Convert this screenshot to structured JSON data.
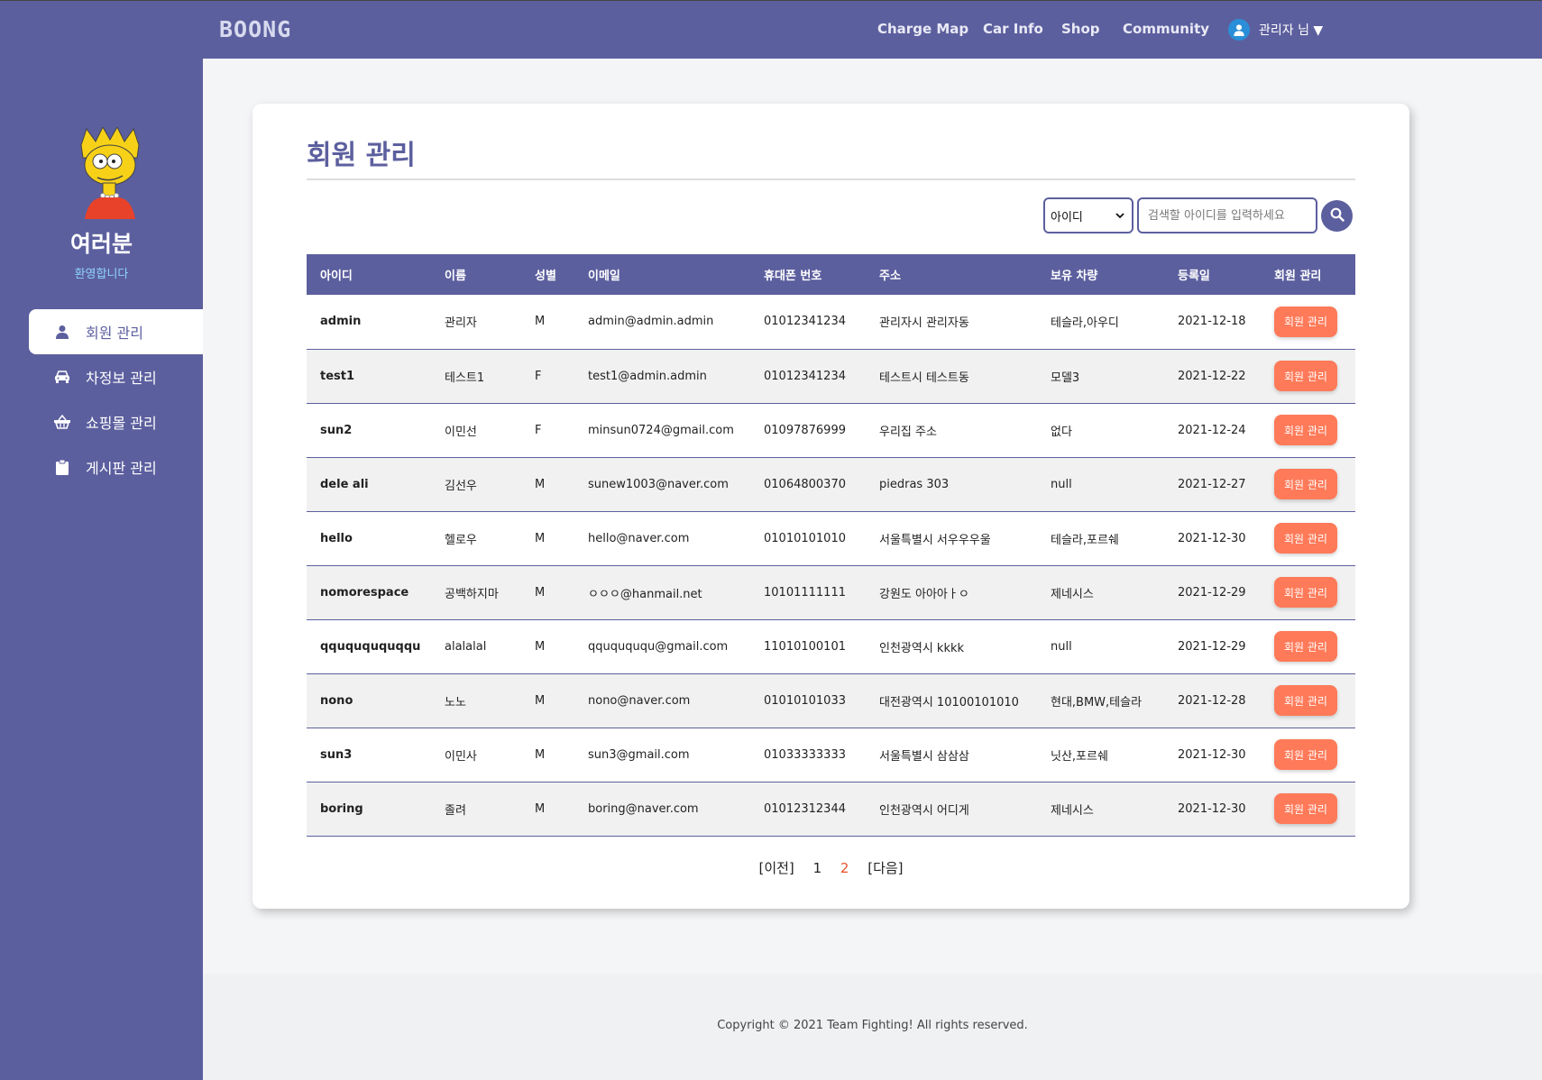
{
  "header": {
    "logo": "BOONG",
    "nav": [
      "Charge Map",
      "Car Info",
      "Shop",
      "Community"
    ],
    "user": "관리자 님 ▼"
  },
  "sidebar": {
    "name": "여러분",
    "welcome": "환영합니다",
    "items": [
      {
        "label": "회원 관리",
        "icon": "user-icon",
        "active": true
      },
      {
        "label": "차정보 관리",
        "icon": "car-icon",
        "active": false
      },
      {
        "label": "쇼핑몰 관리",
        "icon": "basket-icon",
        "active": false
      },
      {
        "label": "게시판 관리",
        "icon": "clipboard-icon",
        "active": false
      }
    ]
  },
  "main": {
    "title": "회원 관리",
    "search": {
      "select_value": "아이디",
      "placeholder": "검색할 아이디를 입력하세요"
    },
    "table": {
      "headers": [
        "아이디",
        "이름",
        "성별",
        "이메일",
        "휴대폰 번호",
        "주소",
        "보유 차량",
        "등록일",
        "회원 관리"
      ],
      "rows": [
        [
          "admin",
          "관리자",
          "M",
          "admin@admin.admin",
          "01012341234",
          "관리자시 관리자동",
          "테슬라,아우디",
          "2021-12-18"
        ],
        [
          "test1",
          "테스트1",
          "F",
          "test1@admin.admin",
          "01012341234",
          "테스트시 테스트동",
          "모델3",
          "2021-12-22"
        ],
        [
          "sun2",
          "이민선",
          "F",
          "minsun0724@gmail.com",
          "01097876999",
          "우리집 주소",
          "없다",
          "2021-12-24"
        ],
        [
          "dele ali",
          "김선우",
          "M",
          "sunew1003@naver.com",
          "01064800370",
          "piedras 303",
          "null",
          "2021-12-27"
        ],
        [
          "hello",
          "헬로우",
          "M",
          "hello@naver.com",
          "01010101010",
          "서울특별시 서우우우울",
          "테슬라,포르쉐",
          "2021-12-30"
        ],
        [
          "nomorespace",
          "공백하지마",
          "M",
          "ㅇㅇㅇ@hanmail.net",
          "10101111111",
          "강원도 아아아ㅏㅇ",
          "제네시스",
          "2021-12-29"
        ],
        [
          "qququququqqu",
          "alalalal",
          "M",
          "qququququ@gmail.com",
          "11010100101",
          "인천광역시 kkkk",
          "null",
          "2021-12-29"
        ],
        [
          "nono",
          "노노",
          "M",
          "nono@naver.com",
          "01010101033",
          "대전광역시 10100101010",
          "현대,BMW,테슬라",
          "2021-12-28"
        ],
        [
          "sun3",
          "이민사",
          "M",
          "sun3@gmail.com",
          "01033333333",
          "서울특별시 삼삼삼",
          "닛산,포르쉐",
          "2021-12-30"
        ],
        [
          "boring",
          "졸려",
          "M",
          "boring@naver.com",
          "01012312344",
          "인천광역시 어디게",
          "제네시스",
          "2021-12-30"
        ]
      ],
      "action_label": "회원 관리"
    },
    "pager": {
      "prev": "[이전]",
      "pages": [
        "1",
        "2"
      ],
      "current": "2",
      "next": "[다음]"
    }
  },
  "footer": {
    "copyright": "Copyright © 2021 Team Fighting! All rights reserved."
  },
  "colors": {
    "primary": "#5c5f9e",
    "accent": "#ff7a59",
    "welcome": "#8fd3ff",
    "current_page": "#e8532b"
  }
}
